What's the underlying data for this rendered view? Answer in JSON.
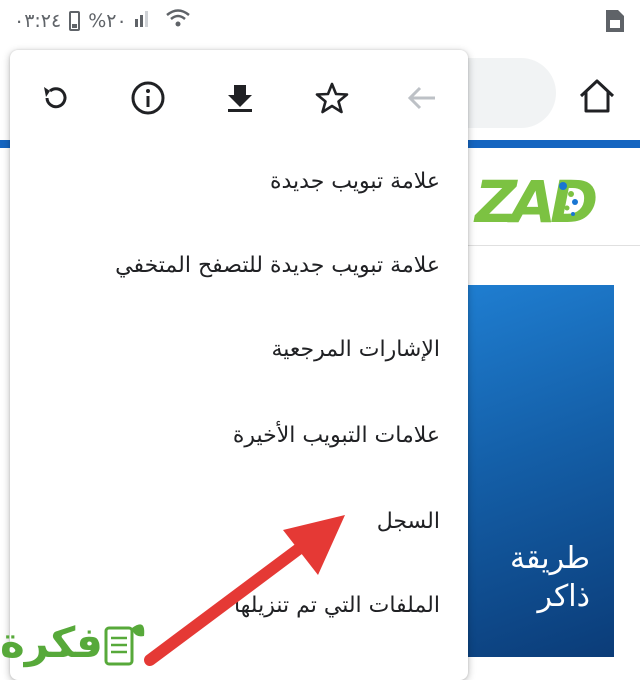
{
  "status_bar": {
    "time": "٠٣:٢٤",
    "battery": "%٢٠"
  },
  "menu": {
    "icons": [
      "refresh-icon",
      "info-icon",
      "download-icon",
      "star-icon",
      "back-arrow-icon"
    ],
    "items": [
      {
        "label": "علامة تبويب جديدة"
      },
      {
        "label": "علامة تبويب جديدة للتصفح المتخفي"
      },
      {
        "label": "الإشارات المرجعية"
      },
      {
        "label": "علامات التبويب الأخيرة"
      },
      {
        "label": "السجل"
      },
      {
        "label": "الملفات التي تم تنزيلها"
      }
    ]
  },
  "page": {
    "logo": "ZAD",
    "article_title": "طريقة\nذاكر"
  },
  "watermark": {
    "text": "فكرة"
  },
  "colors": {
    "accent_blue": "#1565c0",
    "arrow_red": "#e53935",
    "logo_green": "#7cc242"
  }
}
